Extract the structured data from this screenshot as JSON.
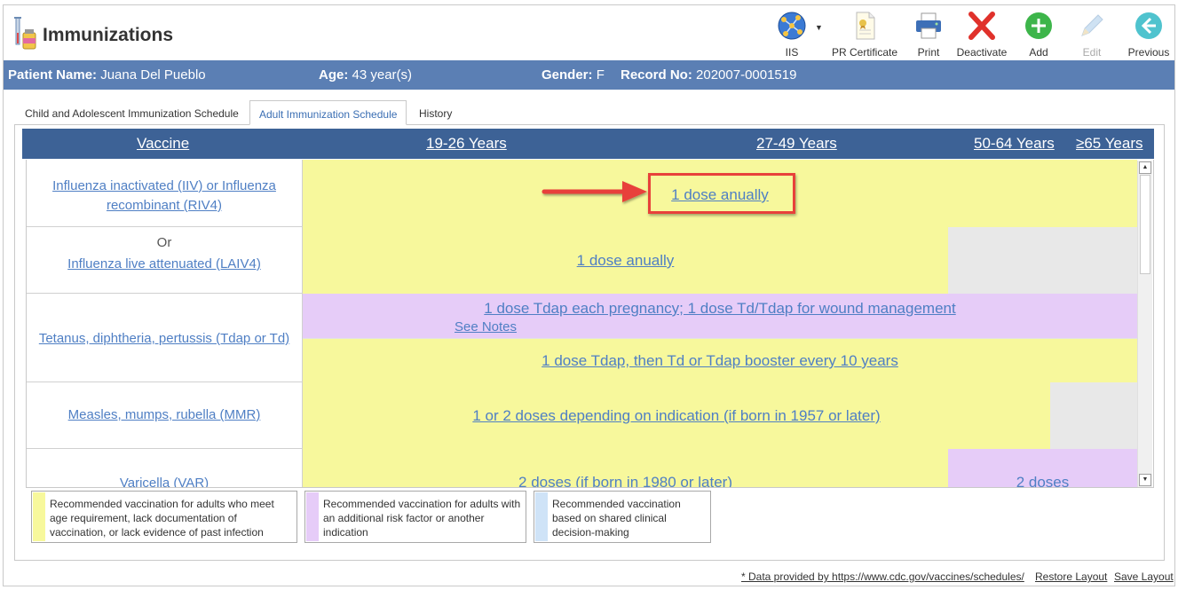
{
  "app": {
    "title": "Immunizations",
    "logo_icon": "syringe-vial-icon"
  },
  "toolbar": {
    "iis": {
      "label": "IIS",
      "icon": "network-globe-icon"
    },
    "pr_certificate": {
      "label": "PR Certificate",
      "icon": "certificate-icon"
    },
    "print": {
      "label": "Print",
      "icon": "printer-icon"
    },
    "deactivate": {
      "label": "Deactivate",
      "icon": "red-x-icon"
    },
    "add": {
      "label": "Add",
      "icon": "green-plus-icon"
    },
    "edit": {
      "label": "Edit",
      "icon": "pencil-icon",
      "disabled": true
    },
    "previous": {
      "label": "Previous",
      "icon": "back-arrow-icon"
    }
  },
  "patient": {
    "name_label": "Patient Name:",
    "name": "Juana Del Pueblo",
    "age_label": "Age:",
    "age": "43 year(s)",
    "gender_label": "Gender:",
    "gender": "F",
    "record_label": "Record No:",
    "record": "202007-0001519"
  },
  "tabs": [
    {
      "label": "Child and Adolescent Immunization Schedule",
      "active": false
    },
    {
      "label": "Adult Immunization Schedule",
      "active": true
    },
    {
      "label": "History",
      "active": false
    }
  ],
  "schedule": {
    "headers": [
      "Vaccine",
      "19-26 Years",
      "27-49 Years",
      "50-64 Years",
      "≥65 Years"
    ],
    "rows": [
      {
        "vaccine": "Influenza inactivated (IIV) or Influenza recombinant (RIV4)",
        "rec": "1 dose anually"
      },
      {
        "or_label": "Or",
        "vaccine": "Influenza live attenuated (LAIV4)",
        "rec": "1 dose anually"
      },
      {
        "vaccine": "Tetanus, diphtheria, pertussis (Tdap or Td)",
        "rec_a": "1 dose Tdap each pregnancy; 1 dose Td/Tdap for wound management",
        "rec_a_note": "See Notes",
        "rec_b": "1 dose Tdap, then Td or Tdap booster every 10 years"
      },
      {
        "vaccine": "Measles, mumps, rubella (MMR)",
        "rec": "1 or 2 doses depending on indication (if born in 1957 or later)"
      },
      {
        "vaccine": "Varicella (VAR)",
        "rec": "2 doses (if born in 1980 or later)",
        "rec_b": "2 doses"
      }
    ]
  },
  "legend": [
    {
      "text": "Recommended vaccination for adults who meet age requirement, lack documentation of vaccination, or lack evidence of past infection",
      "color": "#f7f89c"
    },
    {
      "text": "Recommended vaccination for adults with an additional risk factor or another indication",
      "color": "#e6ccf8"
    },
    {
      "text": "Recommended vaccination based on shared clinical decision-making",
      "color": "#cfe3f7"
    }
  ],
  "footer": {
    "source": "* Data provided by https://www.cdc.gov/vaccines/schedules/",
    "restore": "Restore Layout",
    "save": "Save Layout"
  },
  "colors": {
    "header_bar": "#5b7fb4",
    "schedule_header": "#3d6296",
    "highlight": "#e8413a"
  }
}
